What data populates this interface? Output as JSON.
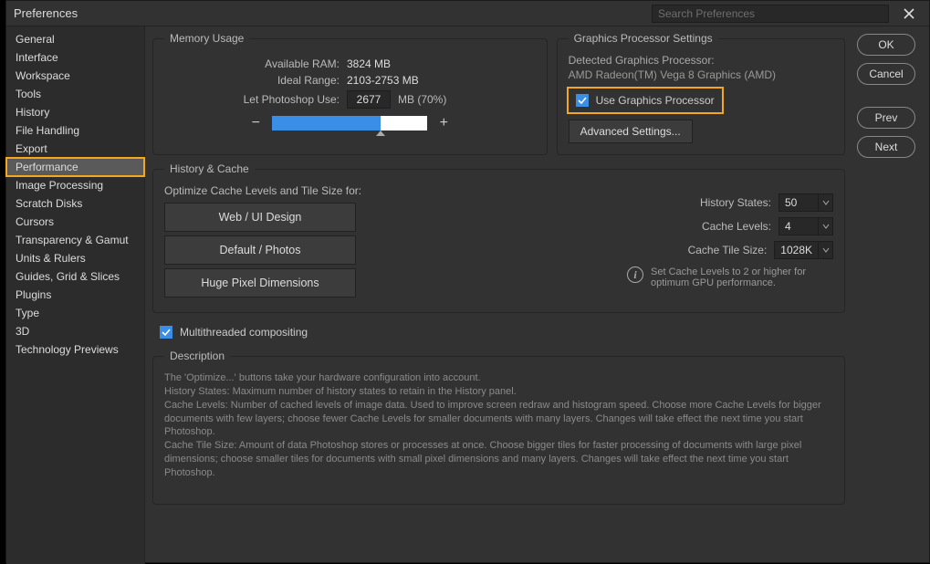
{
  "titlebar": {
    "title": "Preferences",
    "search_placeholder": "Search Preferences"
  },
  "sidebar": {
    "items": [
      "General",
      "Interface",
      "Workspace",
      "Tools",
      "History",
      "File Handling",
      "Export",
      "Performance",
      "Image Processing",
      "Scratch Disks",
      "Cursors",
      "Transparency & Gamut",
      "Units & Rulers",
      "Guides, Grid & Slices",
      "Plugins",
      "Type",
      "3D",
      "Technology Previews"
    ],
    "selected_index": 7
  },
  "buttons": {
    "ok": "OK",
    "cancel": "Cancel",
    "prev": "Prev",
    "next": "Next"
  },
  "memory": {
    "legend": "Memory Usage",
    "available_label": "Available RAM:",
    "available_value": "3824 MB",
    "ideal_label": "Ideal Range:",
    "ideal_value": "2103-2753 MB",
    "use_label": "Let Photoshop Use:",
    "use_value": "2677",
    "use_suffix": "MB (70%)"
  },
  "gpu": {
    "legend": "Graphics Processor Settings",
    "detected_label": "Detected Graphics Processor:",
    "detected_value": "AMD Radeon(TM) Vega 8 Graphics (AMD)",
    "use_checkbox_label": "Use Graphics Processor",
    "advanced_button": "Advanced Settings..."
  },
  "history_cache": {
    "legend": "History & Cache",
    "optimize_label": "Optimize Cache Levels and Tile Size for:",
    "presets": [
      "Web / UI Design",
      "Default / Photos",
      "Huge Pixel Dimensions"
    ],
    "history_states_label": "History States:",
    "history_states_value": "50",
    "cache_levels_label": "Cache Levels:",
    "cache_levels_value": "4",
    "cache_tile_label": "Cache Tile Size:",
    "cache_tile_value": "1028K",
    "hint": "Set Cache Levels to 2 or higher for optimum GPU performance."
  },
  "multithread": {
    "label": "Multithreaded compositing"
  },
  "description": {
    "legend": "Description",
    "lines": [
      "The 'Optimize...' buttons take your hardware configuration into account.",
      "History States: Maximum number of history states to retain in the History panel.",
      "Cache Levels: Number of cached levels of image data.  Used to improve screen redraw and histogram speed.  Choose more Cache Levels for bigger documents with few layers; choose fewer Cache Levels for smaller documents with many layers. Changes will take effect the next time you start Photoshop.",
      "Cache Tile Size: Amount of data Photoshop stores or processes at once. Choose bigger tiles for faster processing of documents with large pixel dimensions; choose smaller tiles for documents with small pixel dimensions and many layers. Changes will take effect the next time you start Photoshop."
    ]
  }
}
